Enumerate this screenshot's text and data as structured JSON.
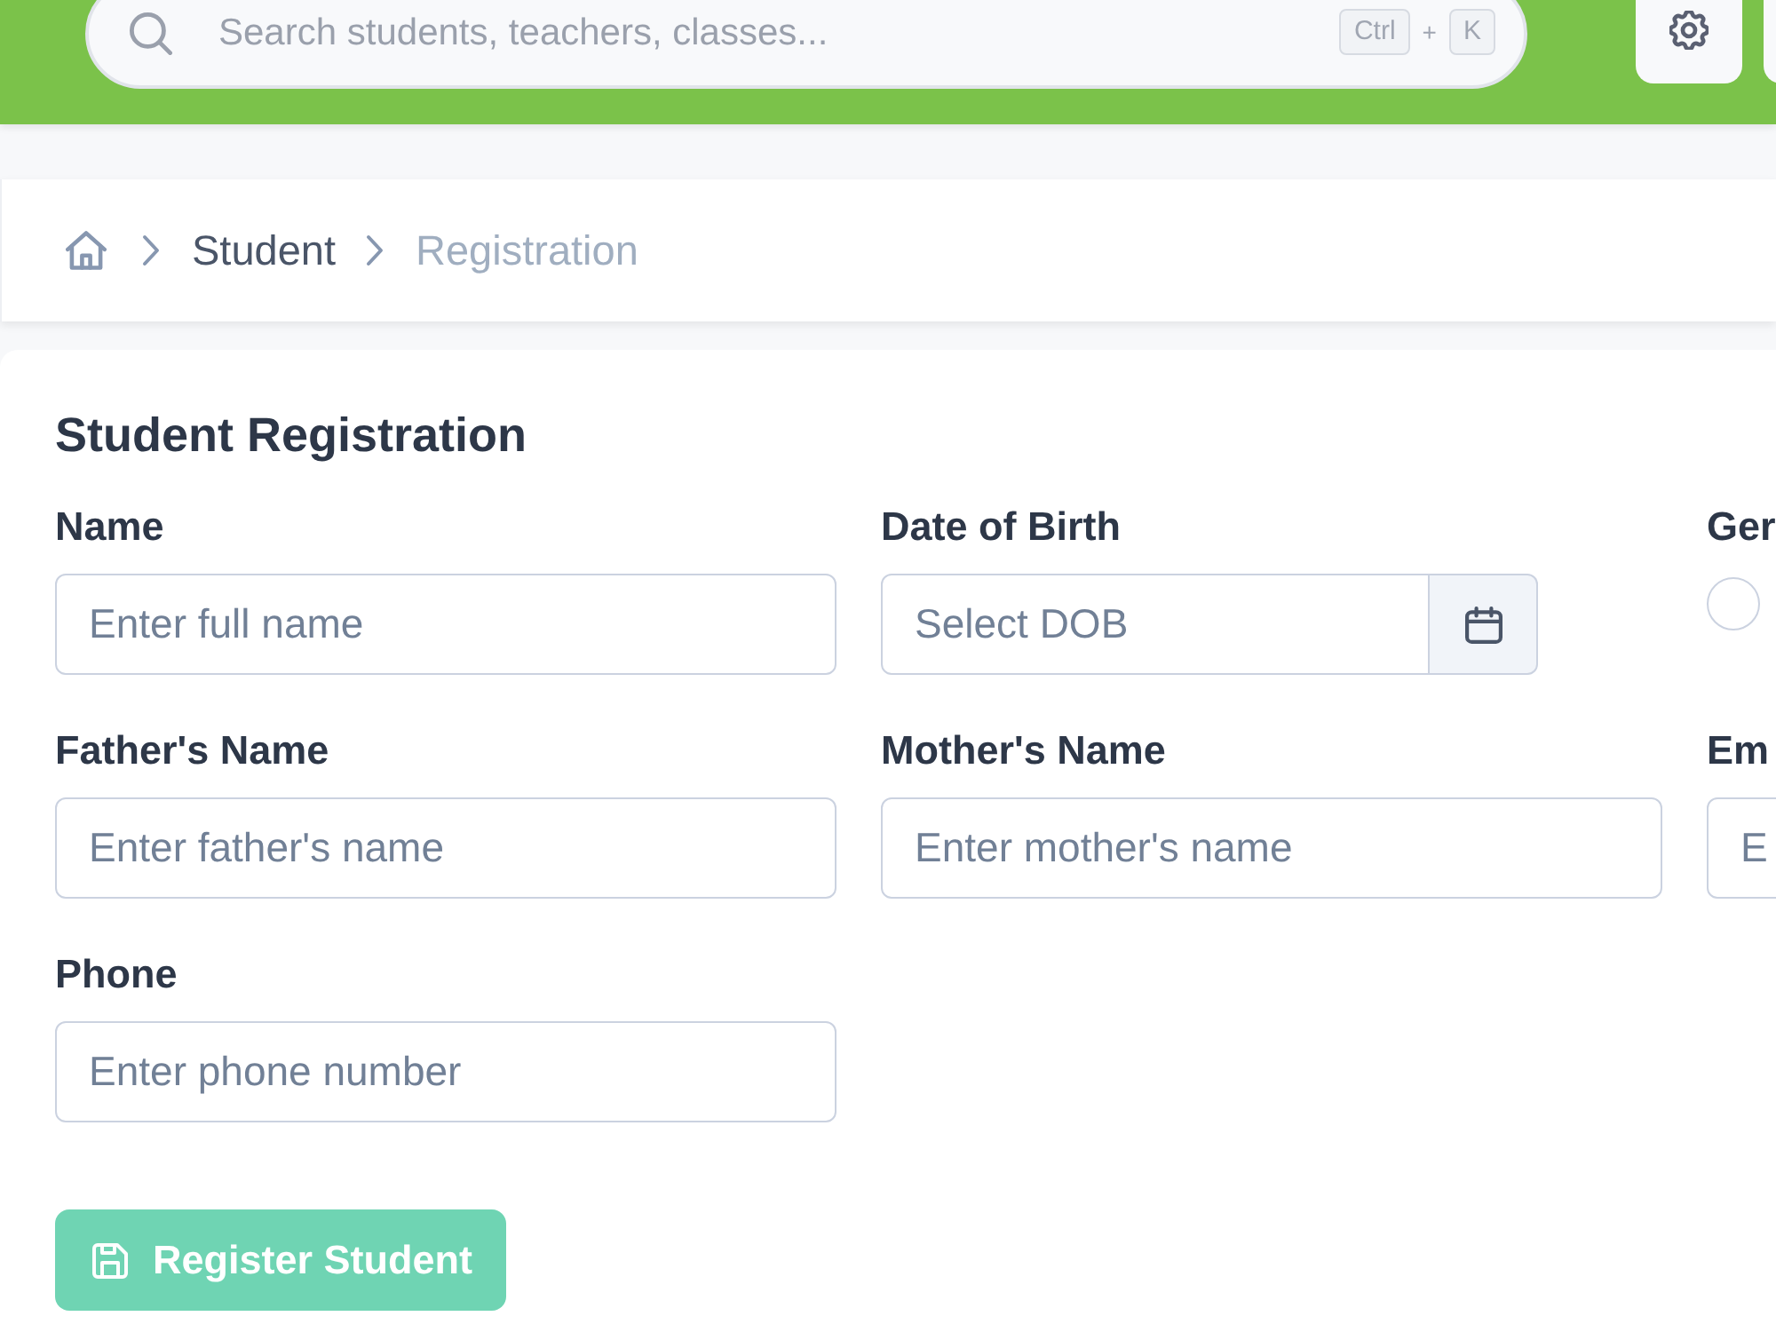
{
  "header": {
    "search": {
      "placeholder": "Search students, teachers, classes...",
      "shortcut": [
        {
          "kind": "key",
          "text": "Ctrl"
        },
        {
          "kind": "separator",
          "text": "+"
        },
        {
          "kind": "key",
          "text": "K"
        }
      ]
    }
  },
  "breadcrumb": {
    "items": [
      {
        "label": "Student",
        "current": false
      },
      {
        "label": "Registration",
        "current": true
      }
    ]
  },
  "form": {
    "title": "Student Registration",
    "fields": [
      {
        "kind": "text",
        "label": "Name",
        "placeholder": "Enter full name"
      },
      {
        "kind": "date",
        "label": "Date of Birth",
        "placeholder": "Select DOB"
      },
      {
        "kind": "radio",
        "label": "Ger",
        "options": [
          {
            "selected": false
          }
        ]
      },
      {
        "kind": "text",
        "label": "Father's Name",
        "placeholder": "Enter father's name"
      },
      {
        "kind": "text",
        "label": "Mother's Name",
        "placeholder": "Enter mother's name"
      },
      {
        "kind": "text",
        "label": "Em",
        "placeholder": "E"
      },
      {
        "kind": "text",
        "label": "Phone",
        "placeholder": "Enter phone number"
      }
    ],
    "submit": {
      "label": "Register Student",
      "disabled": true
    }
  }
}
